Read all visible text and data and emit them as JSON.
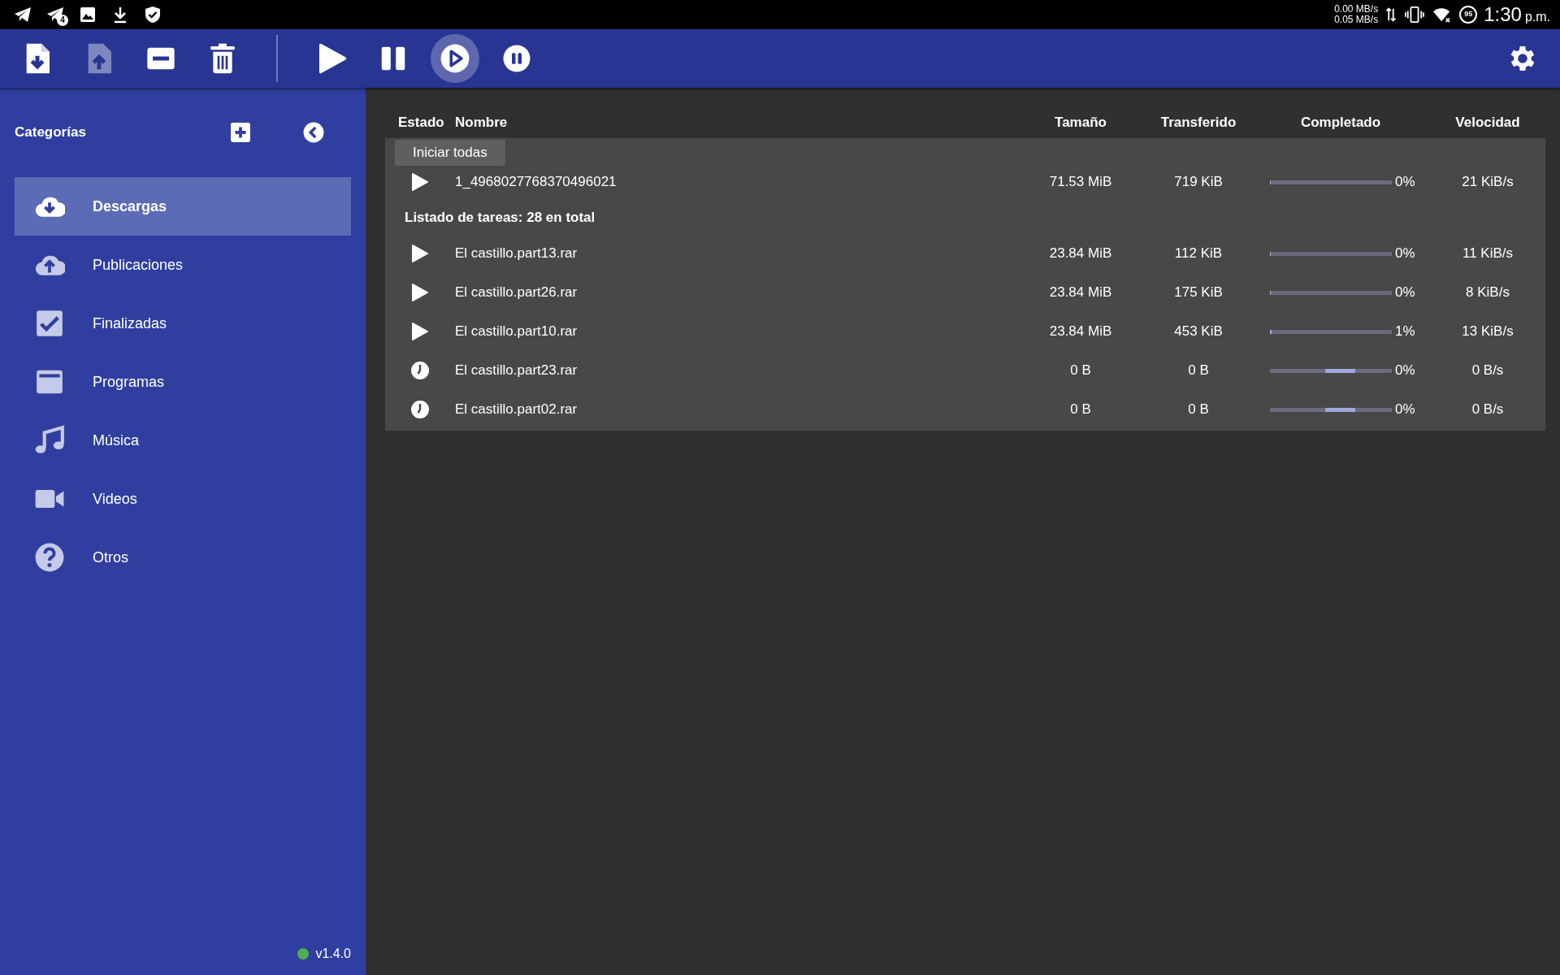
{
  "status_bar": {
    "badge": "4",
    "speeds": [
      "0.00 MB/s",
      "0.05 MB/s"
    ],
    "battery": "95",
    "time": "1:30",
    "ampm": "p.m."
  },
  "toolbar": {
    "buttons": [
      {
        "disabled": false,
        "highlighted": false
      },
      {
        "disabled": true,
        "highlighted": false
      },
      {
        "disabled": false,
        "highlighted": false
      },
      {
        "disabled": false,
        "highlighted": false
      },
      {
        "disabled": false,
        "highlighted": false
      },
      {
        "disabled": false,
        "highlighted": false
      },
      {
        "disabled": false,
        "highlighted": true
      },
      {
        "disabled": false,
        "highlighted": false
      }
    ]
  },
  "sidebar": {
    "title": "Categorías",
    "items": [
      {
        "label": "Descargas",
        "selected": true
      },
      {
        "label": "Publicaciones",
        "selected": false
      },
      {
        "label": "Finalizadas",
        "selected": false
      },
      {
        "label": "Programas",
        "selected": false
      },
      {
        "label": "Música",
        "selected": false
      },
      {
        "label": "Videos",
        "selected": false
      },
      {
        "label": "Otros",
        "selected": false
      }
    ],
    "version": {
      "text": "v1.4.0",
      "color": "#4caf50"
    }
  },
  "tooltip": "Iniciar todas",
  "table": {
    "columns": [
      "Estado",
      "Nombre",
      "Tamaño",
      "Transferido",
      "Completado",
      "Velocidad"
    ],
    "rows": [
      {
        "kind": "task",
        "name": "1_4968027768370496021",
        "size": "71.53 MiB",
        "transferred": "719 KiB",
        "level": 0,
        "percent": "0%",
        "speed": "21 KiB/s"
      },
      {
        "kind": "group",
        "label": "Listado de tareas: 28 en total"
      },
      {
        "kind": "task",
        "name": "El castillo.part13.rar",
        "size": "23.84 MiB",
        "transferred": "112 KiB",
        "level": 0,
        "percent": "0%",
        "speed": "11 KiB/s"
      },
      {
        "kind": "task",
        "name": "El castillo.part26.rar",
        "size": "23.84 MiB",
        "transferred": "175 KiB",
        "level": 0,
        "percent": "0%",
        "speed": "8 KiB/s"
      },
      {
        "kind": "task",
        "name": "El castillo.part10.rar",
        "size": "23.84 MiB",
        "transferred": "453 KiB",
        "level": 0.01,
        "percent": "1%",
        "speed": "13 KiB/s"
      },
      {
        "kind": "queued",
        "name": "El castillo.part23.rar",
        "size": "0 B",
        "transferred": "0 B",
        "indeterminate": true,
        "percent": "0%",
        "speed": "0 B/s"
      },
      {
        "kind": "queued",
        "name": "El castillo.part02.rar",
        "size": "0 B",
        "transferred": "0 B",
        "indeterminate": true,
        "percent": "0%",
        "speed": "0 B/s"
      }
    ]
  }
}
